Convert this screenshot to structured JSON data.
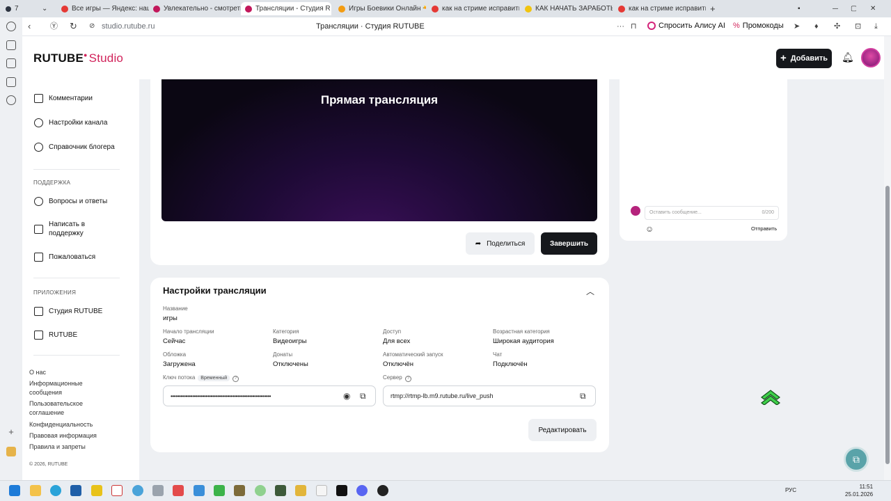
{
  "colors": {
    "accent": "#d1225a",
    "dark_button": "#16181c",
    "help_fab": "#5aa3a9"
  },
  "browser": {
    "tab_number": "7",
    "tabs": [
      {
        "title": "Все игры — Яндекс: нашл",
        "icon": "yandex-icon",
        "color": "#e53935"
      },
      {
        "title": "Увлекательно - смотреть ог",
        "icon": "rutube-icon",
        "color": "#c2185b"
      },
      {
        "title": "Трансляции - Студия R",
        "icon": "rutube-icon",
        "color": "#c2185b"
      },
      {
        "title": "Игры Боевики Онлайн 🔫",
        "icon": "game-icon",
        "color": "#f39c12"
      },
      {
        "title": "как на стриме исправить",
        "icon": "yandex-icon",
        "color": "#e53935"
      },
      {
        "title": "КАК НАЧАТЬ ЗАРАБОТЫ",
        "icon": "youtube-icon",
        "color": "#f1c40f"
      },
      {
        "title": "как на стриме исправить",
        "icon": "yandex-icon",
        "color": "#e53935"
      }
    ],
    "url": "studio.rutube.ru",
    "page_title": "Трансляции · Студия RUTUBE",
    "alice_label": "Спросить Алису AI",
    "promo_label": "Промокоды"
  },
  "header": {
    "logo_main": "RUTUBE",
    "logo_suffix": "Studio",
    "add_label": "Добавить"
  },
  "sidebar": {
    "items_top": [
      {
        "label": "Комментарии",
        "icon": "comments-icon"
      },
      {
        "label": "Настройки канала",
        "icon": "gear-icon"
      },
      {
        "label": "Справочник блогера",
        "icon": "info-icon"
      }
    ],
    "support_title": "ПОДДЕРЖКА",
    "support_items": [
      {
        "label": "Вопросы и ответы",
        "icon": "question-icon"
      },
      {
        "label": "Написать в поддержку",
        "icon": "mail-icon"
      },
      {
        "label": "Пожаловаться",
        "icon": "flag-icon"
      }
    ],
    "apps_title": "ПРИЛОЖЕНИЯ",
    "apps_items": [
      {
        "label": "Студия RUTUBE",
        "icon": "studio-app-icon"
      },
      {
        "label": "RUTUBE",
        "icon": "rutube-app-icon"
      }
    ],
    "footer_links": [
      "О нас",
      "Информационные сообщения",
      "Пользовательское соглашение",
      "Конфиденциальность",
      "Правовая информация",
      "Правила и запреты"
    ],
    "copyright": "© 2026, RUTUBE"
  },
  "stream": {
    "video_title": "Прямая трансляция",
    "share_label": "Поделиться",
    "end_label": "Завершить"
  },
  "settings": {
    "title": "Настройки трансляции",
    "name_label": "Название",
    "name_value": "игры",
    "start_label": "Начало трансляции",
    "start_value": "Сейчас",
    "category_label": "Категория",
    "category_value": "Видеоигры",
    "access_label": "Доступ",
    "access_value": "Для всех",
    "age_label": "Возрастная категория",
    "age_value": "Широкая аудитория",
    "cover_label": "Обложка",
    "cover_value": "Загружена",
    "donations_label": "Донаты",
    "donations_value": "Отключены",
    "autostart_label": "Автоматический запуск",
    "autostart_value": "Отключён",
    "chat_label": "Чат",
    "chat_value": "Подключён",
    "key_label": "Ключ потока",
    "key_badge": "Временный",
    "key_value": "••••••••••••••••••••••••••••••••••••••••••••••••••••••••••••",
    "server_label": "Сервер",
    "server_value": "rtmp://rtmp-lb.m9.rutube.ru/live_push",
    "edit_label": "Редактировать"
  },
  "chat": {
    "placeholder": "Оставить сообщение...",
    "counter": "0/200",
    "send_label": "Отправить"
  },
  "taskbar": {
    "lang": "РУС",
    "time": "11:51",
    "date": "25.01.2026"
  }
}
